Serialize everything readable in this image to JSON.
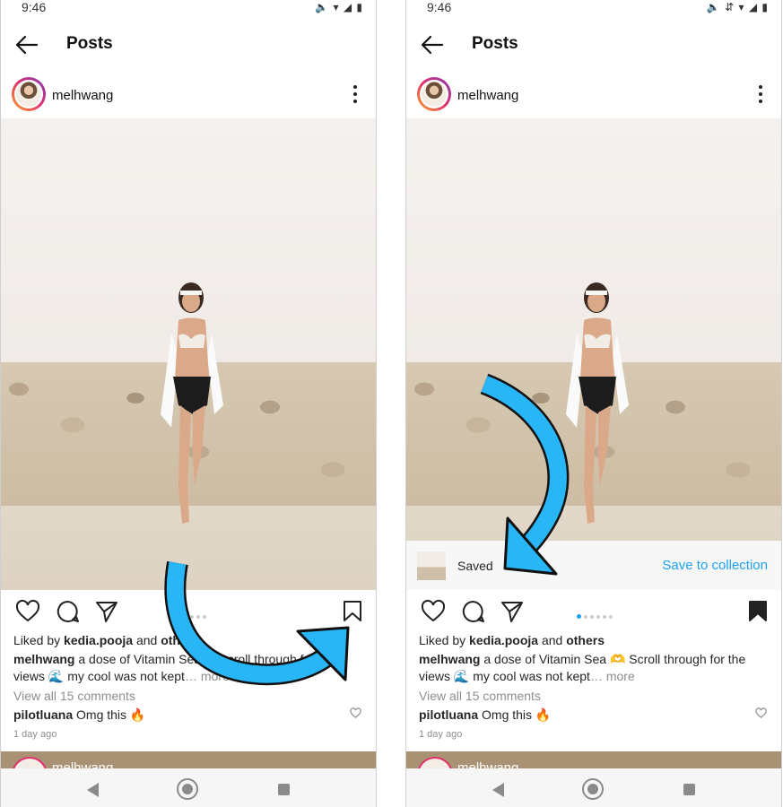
{
  "status_bar": {
    "time": "9:46",
    "icons_left": "🔈 ▾ ◢ ▮",
    "icons_right": "🔈 ⇵ ▾ ◢ ▮"
  },
  "header": {
    "title": "Posts"
  },
  "post": {
    "username": "melhwang",
    "liked_by_prefix": "Liked by ",
    "liked_by_user": "kedia.pooja",
    "liked_by_and": " and ",
    "liked_by_others": "others",
    "caption_user": "melhwang",
    "caption_text_left": " a dose of Vitamin Sea ☀ Scroll through for the views 🌊 my cool was not kept",
    "caption_text_right": " a dose of Vitamin Sea 🫶 Scroll through for the views 🌊 my cool was not kept",
    "more_label": "… more",
    "view_comments": "View all 15 comments",
    "comment_user": "pilotluana",
    "comment_text": " Omg this 🔥",
    "time_ago": "1 day ago"
  },
  "toast": {
    "saved_label": "Saved",
    "collection_link": "Save to collection"
  },
  "next_post": {
    "username": "melhwang"
  },
  "colors": {
    "accent": "#1da1f2",
    "arrow": "#29b6f6",
    "text": "#262626",
    "muted": "#8e8e8e"
  },
  "icons": [
    "back-arrow-icon",
    "more-options-icon",
    "heart-icon",
    "comment-icon",
    "share-icon",
    "bookmark-icon",
    "bookmark-filled-icon",
    "nav-back-icon",
    "nav-home-icon",
    "nav-recents-icon"
  ],
  "carousel": {
    "total": 6,
    "active": 1
  }
}
